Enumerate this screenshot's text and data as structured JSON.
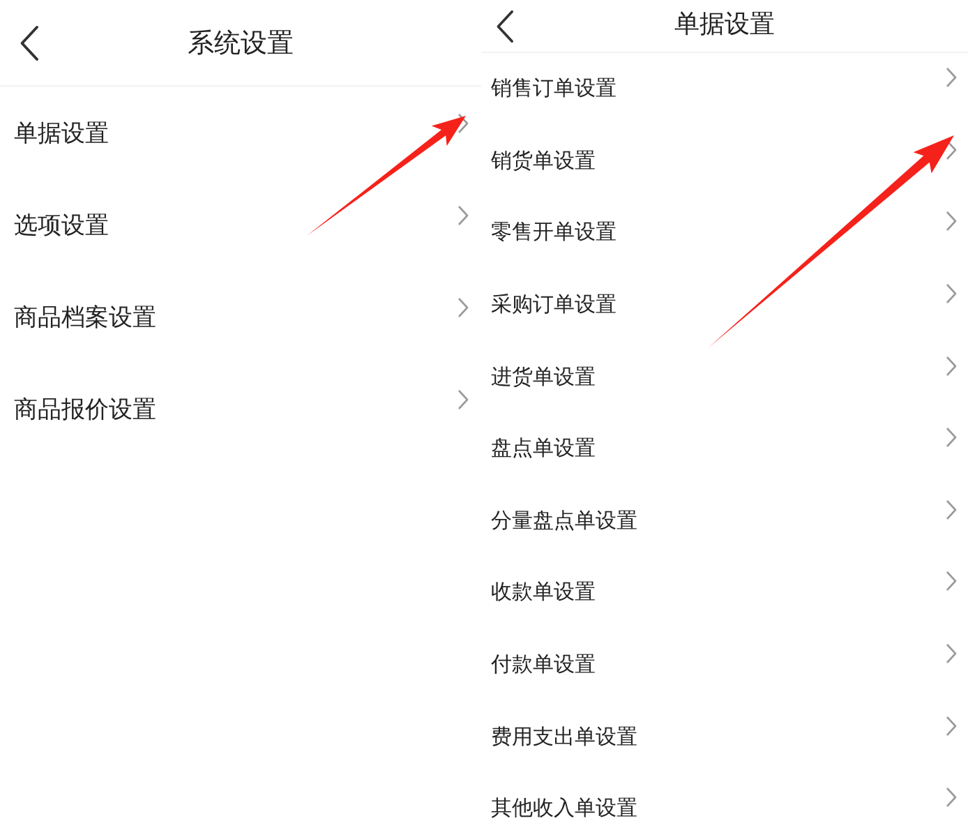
{
  "panels": [
    {
      "title": "系统设置",
      "items": [
        {
          "label": "单据设置",
          "annotated": true
        },
        {
          "label": "选项设置",
          "annotated": false
        },
        {
          "label": "商品档案设置",
          "annotated": false
        },
        {
          "label": "商品报价设置",
          "annotated": false
        }
      ]
    },
    {
      "title": "单据设置",
      "items": [
        {
          "label": "销售订单设置",
          "annotated": false
        },
        {
          "label": "销货单设置",
          "annotated": true
        },
        {
          "label": "零售开单设置",
          "annotated": false
        },
        {
          "label": "采购订单设置",
          "annotated": false
        },
        {
          "label": "进货单设置",
          "annotated": false
        },
        {
          "label": "盘点单设置",
          "annotated": false
        },
        {
          "label": "分量盘点单设置",
          "annotated": false
        },
        {
          "label": "收款单设置",
          "annotated": false
        },
        {
          "label": "付款单设置",
          "annotated": false
        },
        {
          "label": "费用支出单设置",
          "annotated": false
        },
        {
          "label": "其他收入单设置",
          "annotated": false
        }
      ]
    }
  ]
}
